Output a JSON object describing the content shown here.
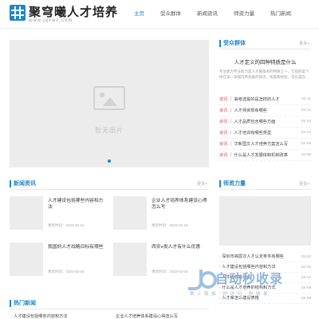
{
  "header": {
    "logo_text": "聚穹曦人才培养",
    "logo_sub": "www.jqxwz.com",
    "nav": [
      {
        "label": "主页",
        "active": true
      },
      {
        "label": "受众群体",
        "active": false
      },
      {
        "label": "新闻资讯",
        "active": false
      },
      {
        "label": "师资力量",
        "active": false
      },
      {
        "label": "热门新闻",
        "active": false
      }
    ]
  },
  "slider": {
    "placeholder_text": "暂无图片"
  },
  "audience": {
    "title": "受众群体",
    "more": "更多+",
    "feature_title": "人才定义的四种特质是什么",
    "feature_desc": "专业能力专业能力是人才最基本的特质之一，它指的是个体在某一领域内所具备的知识、技能和经验。无论是在...",
    "items": [
      {
        "cat": "资讯",
        "title": "高考选拔的是怎样的人才",
        "date": "02-11"
      },
      {
        "cat": "资讯",
        "title": "人才师资现有哪些",
        "date": "02-12"
      },
      {
        "cat": "资讯",
        "title": "人才品质包含哪些方面",
        "date": "02-10"
      },
      {
        "cat": "资讯",
        "title": "人才培训有哪些类型",
        "date": "02-12"
      },
      {
        "cat": "资讯",
        "title": "华新国文人才培养方案怎么写",
        "date": "02-09"
      },
      {
        "cat": "资讯",
        "title": "什么是人才发展体制机制改革",
        "date": "02-09"
      }
    ]
  },
  "news": {
    "title": "新闻资讯",
    "more": "更多+",
    "items": [
      {
        "title": "人才建设包括哪些内容和方法",
        "meta": "更新时间：2023-02-16"
      },
      {
        "title": "企业人才培养体系建设心得怎么写",
        "meta": "更新时间：2023-02-15"
      },
      {
        "title": "我国的人才战略目标有哪些",
        "meta": "更新时间：2023-02-08"
      },
      {
        "title": "西安e类人才有什么优惠",
        "meta": "更新时间：2023-02-09"
      }
    ]
  },
  "teachers": {
    "title": "师资力量",
    "more": "更多+",
    "items": [
      {
        "cat": "",
        "title": "深圳市高层次人才认定条件有哪些",
        "date": "02-02"
      },
      {
        "cat": "",
        "title": "人才建设包括哪些内容和方法",
        "date": "02-16"
      },
      {
        "cat": "",
        "title": "人才培训是什么",
        "date": "02-12"
      },
      {
        "cat": "",
        "title": "什么是人才培养的结构和方式",
        "date": "02-09"
      },
      {
        "cat": "",
        "title": "人才库怎么建设表格",
        "date": "02-08"
      }
    ]
  },
  "hot": {
    "title": "热门新闻",
    "more": "更多+",
    "items": [
      {
        "title": "人才建设包括哪些内容和方法"
      },
      {
        "title": "企业人才培养体系建设心得怎么写"
      }
    ]
  },
  "watermark": {
    "text": "自动秒收录",
    "sub": "数 上 链 接 · 秒 访 问 · 秒 收 录"
  },
  "colors": {
    "accent": "#1f86c9",
    "category": "#e04a4a"
  }
}
